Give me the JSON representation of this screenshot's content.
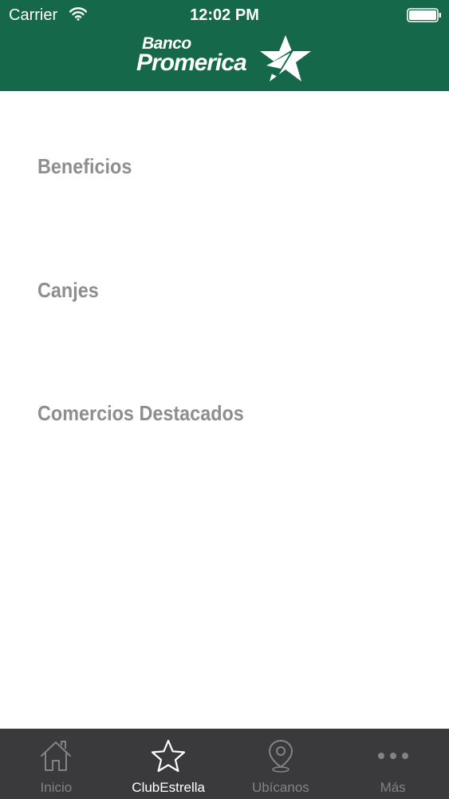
{
  "status_bar": {
    "carrier": "Carrier",
    "time": "12:02 PM"
  },
  "header": {
    "logo_line1": "Banco",
    "logo_line2": "Promerica",
    "background_color": "#15694a"
  },
  "menu": {
    "items": [
      {
        "label": "Beneficios"
      },
      {
        "label": "Canjes"
      },
      {
        "label": "Comercios Destacados"
      }
    ]
  },
  "tab_bar": {
    "tabs": [
      {
        "label": "Inicio",
        "icon": "home-icon",
        "active": false
      },
      {
        "label": "ClubEstrella",
        "icon": "star-icon",
        "active": true
      },
      {
        "label": "Ubícanos",
        "icon": "map-pin-icon",
        "active": false
      },
      {
        "label": "Más",
        "icon": "more-icon",
        "active": false
      }
    ]
  }
}
